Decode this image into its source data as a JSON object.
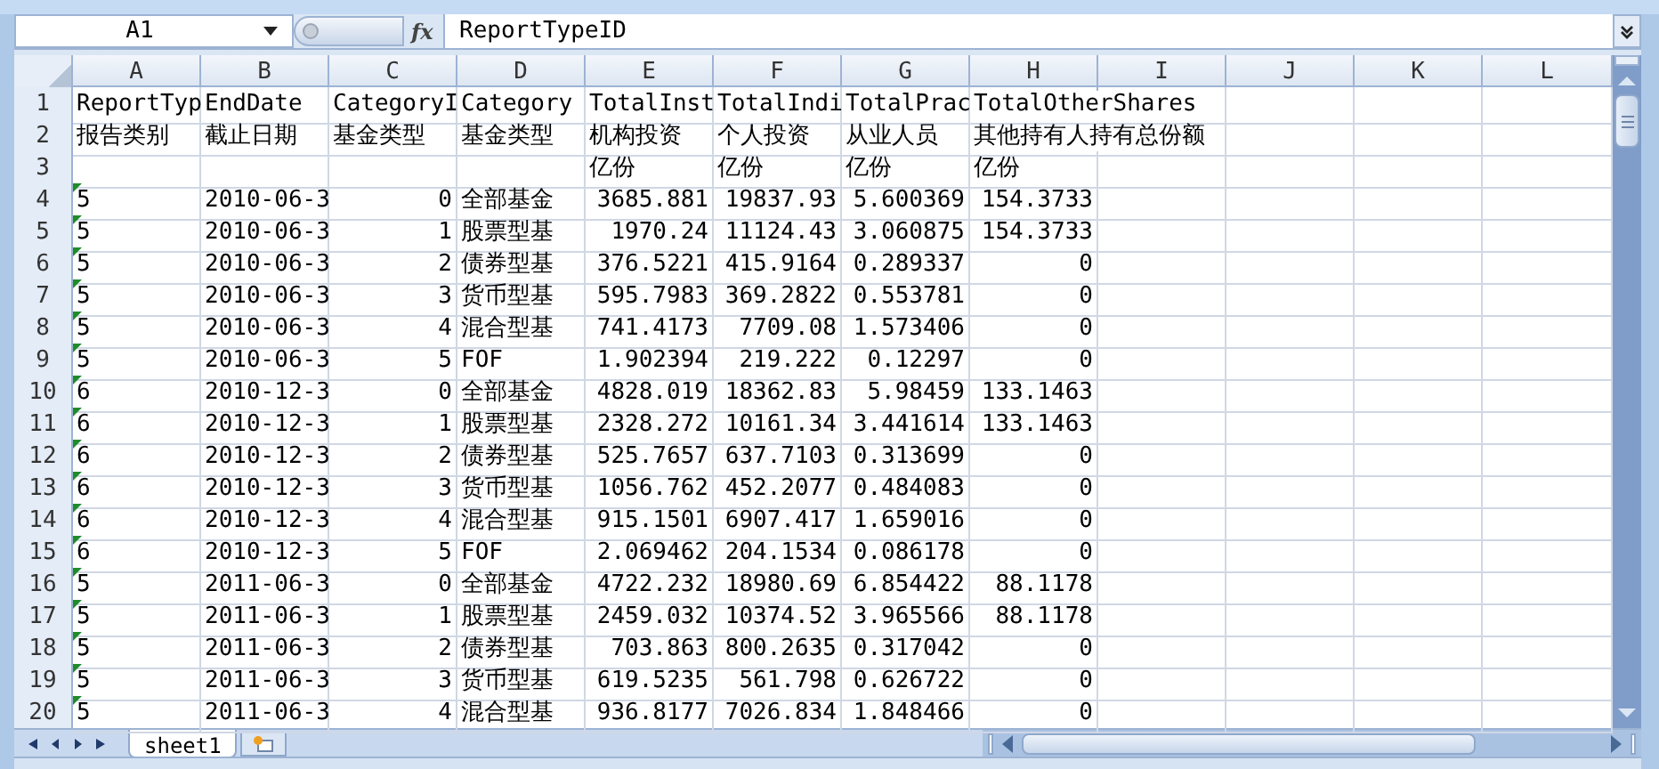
{
  "formula_bar": {
    "cell_ref": "A1",
    "function_label": "fx",
    "formula": "ReportTypeID"
  },
  "columns": [
    "A",
    "B",
    "C",
    "D",
    "E",
    "F",
    "G",
    "H",
    "I",
    "J",
    "K",
    "L"
  ],
  "rows": [
    {
      "number": "1",
      "kind": "header",
      "flagged": false,
      "cells": [
        "ReportTyp",
        "EndDate",
        "CategoryI",
        "Category",
        "TotalInst",
        "TotalIndi",
        "TotalPrac",
        "TotalOtherShares"
      ]
    },
    {
      "number": "2",
      "kind": "header",
      "flagged": false,
      "cells": [
        "报告类别",
        "截止日期",
        "基金类型",
        "基金类型",
        "机构投资",
        "个人投资",
        "从业人员",
        "其他持有人持有总份额"
      ]
    },
    {
      "number": "3",
      "kind": "header",
      "flagged": false,
      "cells": [
        "",
        "",
        "",
        "",
        "亿份",
        "亿份",
        "亿份",
        "亿份"
      ]
    },
    {
      "number": "4",
      "kind": "data",
      "flagged": true,
      "cells": [
        "5",
        "2010-06-3",
        "0",
        "全部基金",
        "3685.881",
        "19837.93",
        "5.600369",
        "154.3733"
      ]
    },
    {
      "number": "5",
      "kind": "data",
      "flagged": true,
      "cells": [
        "5",
        "2010-06-3",
        "1",
        "股票型基",
        "1970.24",
        "11124.43",
        "3.060875",
        "154.3733"
      ]
    },
    {
      "number": "6",
      "kind": "data",
      "flagged": true,
      "cells": [
        "5",
        "2010-06-3",
        "2",
        "债券型基",
        "376.5221",
        "415.9164",
        "0.289337",
        "0"
      ]
    },
    {
      "number": "7",
      "kind": "data",
      "flagged": true,
      "cells": [
        "5",
        "2010-06-3",
        "3",
        "货币型基",
        "595.7983",
        "369.2822",
        "0.553781",
        "0"
      ]
    },
    {
      "number": "8",
      "kind": "data",
      "flagged": true,
      "cells": [
        "5",
        "2010-06-3",
        "4",
        "混合型基",
        "741.4173",
        "7709.08",
        "1.573406",
        "0"
      ]
    },
    {
      "number": "9",
      "kind": "data",
      "flagged": true,
      "cells": [
        "5",
        "2010-06-3",
        "5",
        "FOF",
        "1.902394",
        "219.222",
        "0.12297",
        "0"
      ]
    },
    {
      "number": "10",
      "kind": "data",
      "flagged": true,
      "cells": [
        "6",
        "2010-12-3",
        "0",
        "全部基金",
        "4828.019",
        "18362.83",
        "5.98459",
        "133.1463"
      ]
    },
    {
      "number": "11",
      "kind": "data",
      "flagged": true,
      "cells": [
        "6",
        "2010-12-3",
        "1",
        "股票型基",
        "2328.272",
        "10161.34",
        "3.441614",
        "133.1463"
      ]
    },
    {
      "number": "12",
      "kind": "data",
      "flagged": true,
      "cells": [
        "6",
        "2010-12-3",
        "2",
        "债券型基",
        "525.7657",
        "637.7103",
        "0.313699",
        "0"
      ]
    },
    {
      "number": "13",
      "kind": "data",
      "flagged": true,
      "cells": [
        "6",
        "2010-12-3",
        "3",
        "货币型基",
        "1056.762",
        "452.2077",
        "0.484083",
        "0"
      ]
    },
    {
      "number": "14",
      "kind": "data",
      "flagged": true,
      "cells": [
        "6",
        "2010-12-3",
        "4",
        "混合型基",
        "915.1501",
        "6907.417",
        "1.659016",
        "0"
      ]
    },
    {
      "number": "15",
      "kind": "data",
      "flagged": true,
      "cells": [
        "6",
        "2010-12-3",
        "5",
        "FOF",
        "2.069462",
        "204.1534",
        "0.086178",
        "0"
      ]
    },
    {
      "number": "16",
      "kind": "data",
      "flagged": true,
      "cells": [
        "5",
        "2011-06-3",
        "0",
        "全部基金",
        "4722.232",
        "18980.69",
        "6.854422",
        "88.1178"
      ]
    },
    {
      "number": "17",
      "kind": "data",
      "flagged": true,
      "cells": [
        "5",
        "2011-06-3",
        "1",
        "股票型基",
        "2459.032",
        "10374.52",
        "3.965566",
        "88.1178"
      ]
    },
    {
      "number": "18",
      "kind": "data",
      "flagged": true,
      "cells": [
        "5",
        "2011-06-3",
        "2",
        "债券型基",
        "703.863",
        "800.2635",
        "0.317042",
        "0"
      ]
    },
    {
      "number": "19",
      "kind": "data",
      "flagged": true,
      "cells": [
        "5",
        "2011-06-3",
        "3",
        "货币型基",
        "619.5235",
        "561.798",
        "0.626722",
        "0"
      ]
    },
    {
      "number": "20",
      "kind": "data",
      "flagged": true,
      "cells": [
        "5",
        "2011-06-3",
        "4",
        "混合型基",
        "936.8177",
        "7026.834",
        "1.848466",
        "0"
      ]
    }
  ],
  "sheet_tabs": [
    {
      "label": "sheet1",
      "selected": true
    }
  ]
}
